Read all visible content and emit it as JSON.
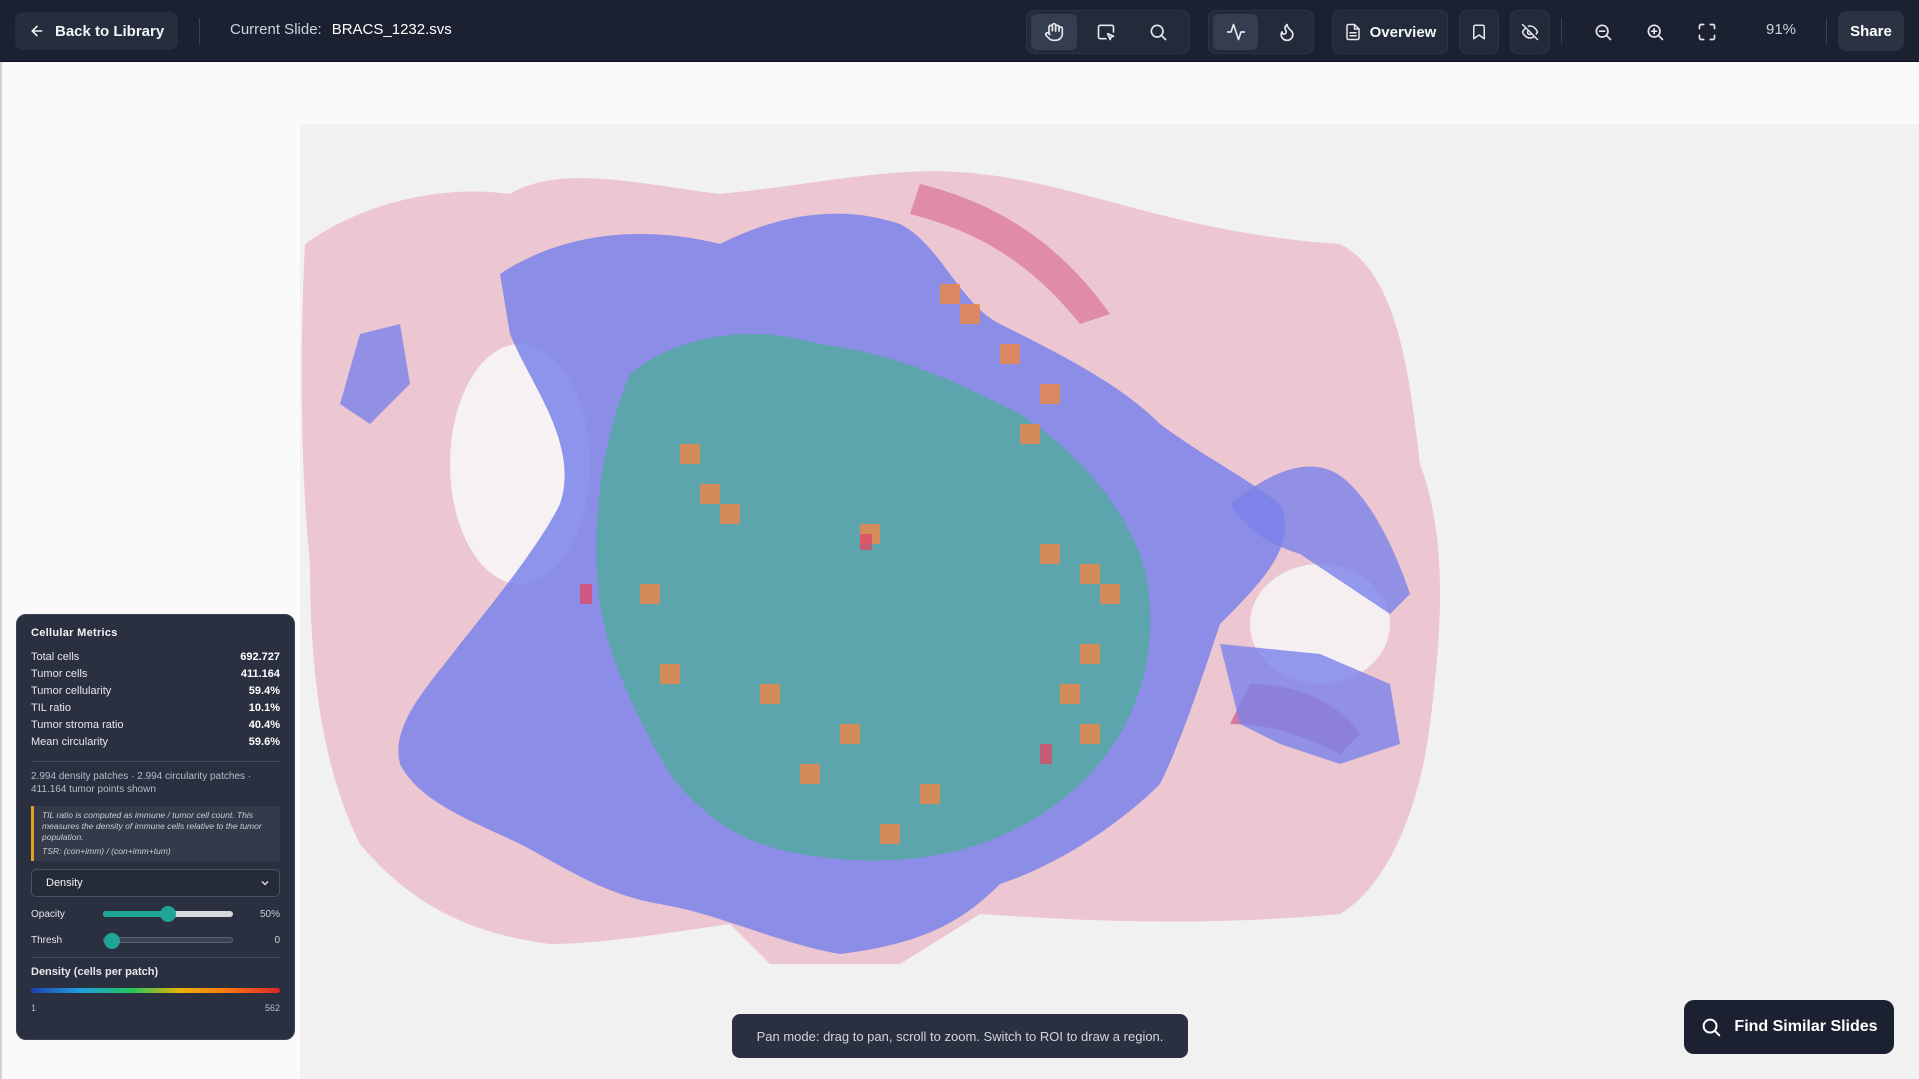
{
  "header": {
    "back_label": "Back to Library",
    "current_slide_label": "Current Slide:",
    "slide_name": "BRACS_1232.svs",
    "overview_label": "Overview",
    "zoom_level": "91%",
    "share_label": "Share",
    "tools": [
      "hand-icon",
      "roi-select-icon",
      "search-icon",
      "activity-icon",
      "flame-icon",
      "document-icon",
      "bookmark-icon",
      "eye-off-icon",
      "zoom-out-icon",
      "zoom-in-icon",
      "fullscreen-icon"
    ]
  },
  "metrics": {
    "title": "Cellular Metrics",
    "rows": [
      {
        "label": "Total cells",
        "value": "692.727"
      },
      {
        "label": "Tumor cells",
        "value": "411.164"
      },
      {
        "label": "Tumor cellularity",
        "value": "59.4%"
      },
      {
        "label": "TIL ratio",
        "value": "10.1%"
      },
      {
        "label": "Tumor stroma ratio",
        "value": "40.4%"
      },
      {
        "label": "Mean circularity",
        "value": "59.6%"
      }
    ],
    "patch_note": "2.994 density patches · 2.994 circularity patches · 411.164 tumor points shown",
    "callout_text": "TIL ratio is computed as immune / tumor cell count. This measures the density of immune cells relative to the tumor population.",
    "callout_formula": "TSR: (con+imm) / (con+imm+tum)",
    "overlay_select": "Density",
    "opacity_label": "Opacity",
    "opacity_value": "50%",
    "opacity_level": 0.5,
    "thresh_label": "Thresh",
    "thresh_value": "0",
    "thresh_level": 0.0,
    "legend_title": "Density (cells per patch)",
    "legend_min": "1",
    "legend_max": "562",
    "colors": {
      "accent": "#1fa595",
      "callout": "#e0a321"
    }
  },
  "toast": {
    "text": "Pan mode: drag to pan, scroll to zoom. Switch to ROI to draw a region."
  },
  "find_similar": {
    "label": "Find Similar Slides"
  }
}
